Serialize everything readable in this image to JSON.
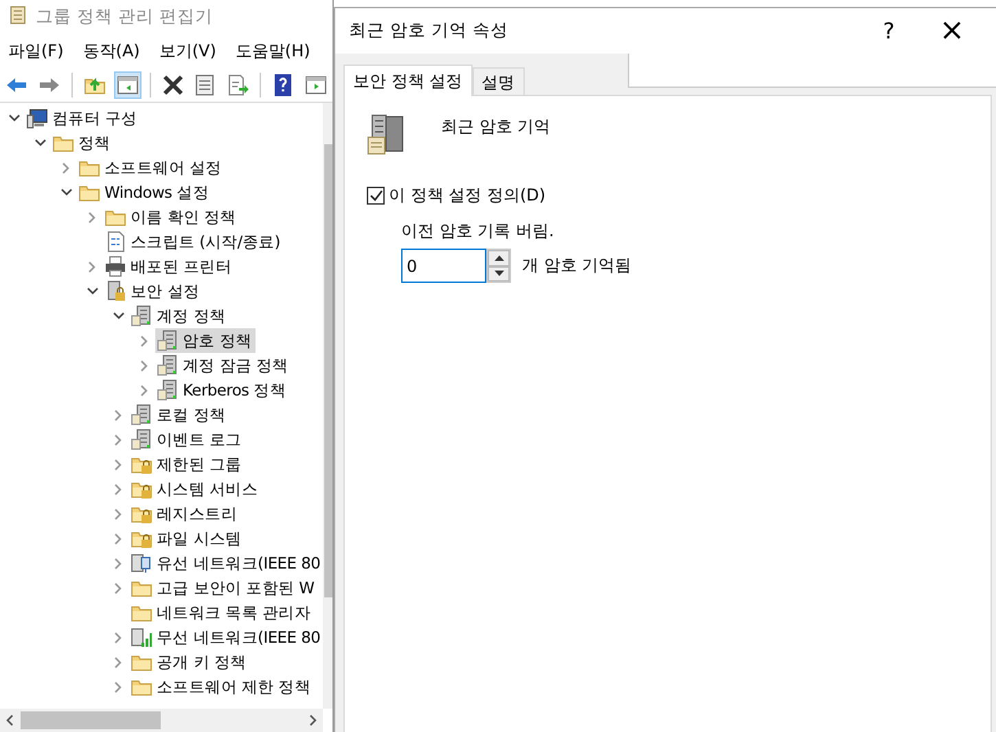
{
  "main_window": {
    "title": "그룹 정책 관리 편집기"
  },
  "menu": [
    "파일(F)",
    "동작(A)",
    "보기(V)",
    "도움말(H)"
  ],
  "toolbar": [
    {
      "kind": "back",
      "selected": false
    },
    {
      "kind": "forward",
      "selected": false
    },
    {
      "kind": "sep"
    },
    {
      "kind": "up",
      "selected": false
    },
    {
      "kind": "pane",
      "selected": true
    },
    {
      "kind": "sep"
    },
    {
      "kind": "delete",
      "selected": false
    },
    {
      "kind": "props",
      "selected": false
    },
    {
      "kind": "export",
      "selected": false
    },
    {
      "kind": "sep"
    },
    {
      "kind": "help",
      "selected": false
    },
    {
      "kind": "view",
      "selected": false
    }
  ],
  "tree": [
    {
      "label": "컴퓨터 구성",
      "kind": "computer",
      "expandable": true,
      "expanded": true,
      "selected": false,
      "children": [
        {
          "label": "정책",
          "kind": "folder",
          "expandable": true,
          "expanded": true,
          "selected": false,
          "children": [
            {
              "label": "소프트웨어 설정",
              "kind": "folder",
              "expandable": true,
              "expanded": false,
              "selected": false
            },
            {
              "label": "Windows 설정",
              "kind": "folder",
              "expandable": true,
              "expanded": true,
              "selected": false,
              "children": [
                {
                  "label": "이름 확인 정책",
                  "kind": "folder",
                  "expandable": true,
                  "expanded": false,
                  "selected": false
                },
                {
                  "label": "스크립트 (시작/종료)",
                  "kind": "script",
                  "expandable": false,
                  "selected": false
                },
                {
                  "label": "배포된 프린터",
                  "kind": "printer",
                  "expandable": true,
                  "expanded": false,
                  "selected": false
                },
                {
                  "label": "보안 설정",
                  "kind": "lockserver",
                  "expandable": true,
                  "expanded": true,
                  "selected": false,
                  "children": [
                    {
                      "label": "계정 정책",
                      "kind": "server",
                      "expandable": true,
                      "expanded": true,
                      "selected": false,
                      "children": [
                        {
                          "label": "암호 정책",
                          "kind": "server",
                          "expandable": true,
                          "expanded": false,
                          "selected": true
                        },
                        {
                          "label": "계정 잠금 정책",
                          "kind": "server",
                          "expandable": true,
                          "expanded": false,
                          "selected": false
                        },
                        {
                          "label": "Kerberos 정책",
                          "kind": "server",
                          "expandable": true,
                          "expanded": false,
                          "selected": false
                        }
                      ]
                    },
                    {
                      "label": "로컬 정책",
                      "kind": "server",
                      "expandable": true,
                      "expanded": false,
                      "selected": false
                    },
                    {
                      "label": "이벤트 로그",
                      "kind": "server",
                      "expandable": true,
                      "expanded": false,
                      "selected": false
                    },
                    {
                      "label": "제한된 그룹",
                      "kind": "lockfolder",
                      "expandable": true,
                      "expanded": false,
                      "selected": false
                    },
                    {
                      "label": "시스템 서비스",
                      "kind": "lockfolder",
                      "expandable": true,
                      "expanded": false,
                      "selected": false
                    },
                    {
                      "label": "레지스트리",
                      "kind": "lockfolder",
                      "expandable": true,
                      "expanded": false,
                      "selected": false
                    },
                    {
                      "label": "파일 시스템",
                      "kind": "lockfolder",
                      "expandable": true,
                      "expanded": false,
                      "selected": false
                    },
                    {
                      "label": "유선 네트워크(IEEE 80",
                      "kind": "network",
                      "expandable": true,
                      "expanded": false,
                      "selected": false
                    },
                    {
                      "label": "고급 보안이 포함된 W",
                      "kind": "folder",
                      "expandable": true,
                      "expanded": false,
                      "selected": false
                    },
                    {
                      "label": "네트워크 목록 관리자",
                      "kind": "folder",
                      "expandable": false,
                      "selected": false
                    },
                    {
                      "label": "무선 네트워크(IEEE 80",
                      "kind": "wifi",
                      "expandable": true,
                      "expanded": false,
                      "selected": false
                    },
                    {
                      "label": "공개 키 정책",
                      "kind": "folder",
                      "expandable": true,
                      "expanded": false,
                      "selected": false
                    },
                    {
                      "label": "소프트웨어 제한 정책",
                      "kind": "folder",
                      "expandable": true,
                      "expanded": false,
                      "selected": false
                    }
                  ]
                }
              ]
            }
          ]
        }
      ]
    }
  ],
  "dialog": {
    "title": "최근 암호 기억 속성",
    "help": "?",
    "close": "×",
    "tabs": [
      {
        "label": "보안 정책 설정",
        "selected": true
      },
      {
        "label": "설명",
        "selected": false
      }
    ],
    "policy_name": "최근 암호 기억",
    "define_checkbox": {
      "label": "이 정책 설정 정의(D)",
      "checked": true
    },
    "field_label": "이전 암호 기록 버림.",
    "spin": {
      "value": "0"
    },
    "unit": "개 암호 기억됨"
  }
}
